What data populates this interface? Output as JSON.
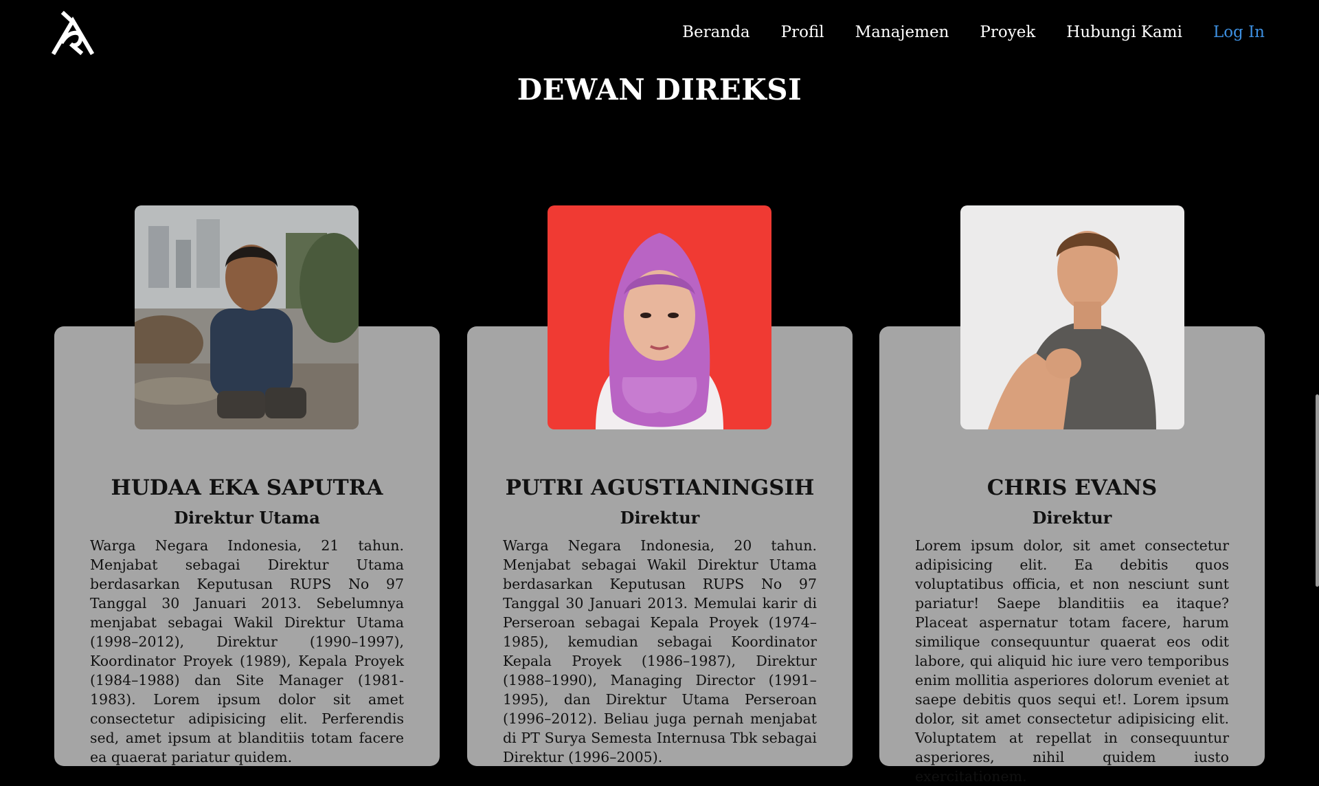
{
  "nav": {
    "items": [
      "Beranda",
      "Profil",
      "Manajemen",
      "Proyek",
      "Hubungi Kami"
    ],
    "login": "Log In",
    "login_color": "#3d8fe0"
  },
  "section": {
    "title": "DEWAN DIREKSI"
  },
  "directors": [
    {
      "name": "HUDAA EKA SAPUTRA",
      "role": "Direktur Utama",
      "bio": "Warga Negara Indonesia, 21 tahun. Menjabat sebagai Direktur Utama berdasarkan Keputusan RUPS No 97 Tanggal 30 Januari 2013. Sebelumnya menjabat sebagai Wakil Direktur Utama (1998–2012), Direktur (1990–1997), Koordinator Proyek (1989), Kepala Proyek (1984–1988) dan Site Manager (1981-1983). Lorem ipsum dolor sit amet consectetur adipisicing elit. Perferendis sed, amet ipsum at blanditiis totam facere ea quaerat pariatur quidem."
    },
    {
      "name": "PUTRI AGUSTIANINGSIH",
      "role": "Direktur",
      "bio": "Warga Negara Indonesia, 20 tahun. Menjabat sebagai Wakil Direktur Utama berdasarkan Keputusan RUPS No 97 Tanggal 30 Januari 2013. Memulai karir di Perseroan sebagai Kepala Proyek (1974–1985), kemudian sebagai Koordinator Kepala Proyek (1986–1987), Direktur (1988–1990), Managing Director (1991–1995), dan Direktur Utama Perseroan (1996–2012). Beliau juga pernah menjabat di PT Surya Semesta Internusa Tbk sebagai Direktur (1996–2005)."
    },
    {
      "name": "CHRIS EVANS",
      "role": "Direktur",
      "bio": "Lorem ipsum dolor, sit amet consectetur adipisicing elit. Ea debitis quos voluptatibus officia, et non nesciunt sunt pariatur! Saepe blanditiis ea itaque? Placeat aspernatur totam facere, harum similique consequuntur quaerat eos odit labore, qui aliquid hic iure vero temporibus enim mollitia asperiores dolorum eveniet at saepe debitis quos sequi et!. Lorem ipsum dolor, sit amet consectetur adipisicing elit. Voluptatem at repellat in consequuntur asperiores, nihil quidem iusto exercitationem."
    }
  ]
}
